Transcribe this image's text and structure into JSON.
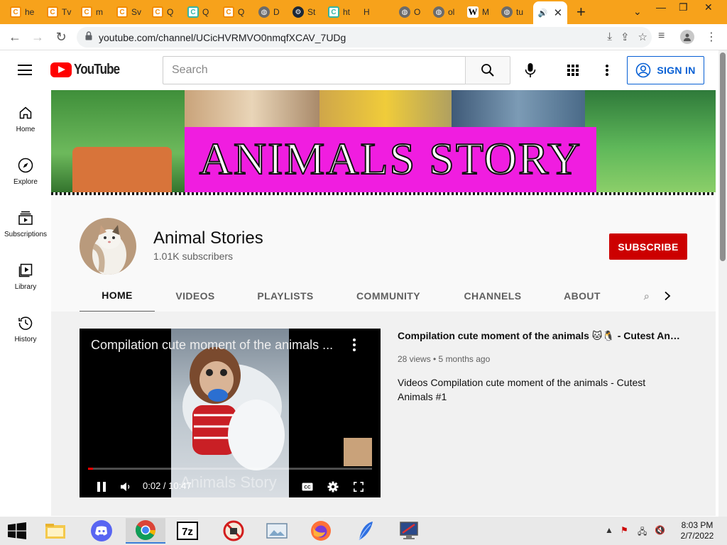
{
  "browser": {
    "tabs": [
      {
        "title": "he",
        "icon": "orange-c-icon"
      },
      {
        "title": "Tv",
        "icon": "orange-c-icon"
      },
      {
        "title": "m",
        "icon": "orange-c-icon"
      },
      {
        "title": "Sv",
        "icon": "orange-c-icon"
      },
      {
        "title": "Q",
        "icon": "orange-c-icon"
      },
      {
        "title": "Q",
        "icon": "teal-c-icon"
      },
      {
        "title": "Q",
        "icon": "orange-c-icon"
      },
      {
        "title": "D",
        "icon": "globe-icon"
      },
      {
        "title": "St",
        "icon": "steam-icon"
      },
      {
        "title": "ht",
        "icon": "teal-c-icon"
      },
      {
        "title": "H",
        "icon": "history-icon"
      },
      {
        "title": "O",
        "icon": "globe-icon"
      },
      {
        "title": "ol",
        "icon": "globe-icon"
      },
      {
        "title": "M",
        "icon": "wikipedia-icon"
      },
      {
        "title": "tu",
        "icon": "globe-icon"
      }
    ],
    "url": "youtube.com/channel/UCicHVRMVO0nmqfXCAV_7UDg"
  },
  "youtube": {
    "logo_text": "YouTube",
    "search_placeholder": "Search",
    "sign_in_label": "SIGN IN",
    "guide": [
      {
        "label": "Home",
        "icon": "home-icon"
      },
      {
        "label": "Explore",
        "icon": "compass-icon"
      },
      {
        "label": "Subscriptions",
        "icon": "subscriptions-icon"
      },
      {
        "label": "Library",
        "icon": "library-icon"
      },
      {
        "label": "History",
        "icon": "history-icon"
      }
    ]
  },
  "channel": {
    "banner_text": "ANIMALS STORY",
    "name": "Animal Stories",
    "subscribers": "1.01K subscribers",
    "subscribe_label": "SUBSCRIBE",
    "tabs": [
      "HOME",
      "VIDEOS",
      "PLAYLISTS",
      "COMMUNITY",
      "CHANNELS",
      "ABOUT"
    ],
    "active_tab": "HOME"
  },
  "featured_video": {
    "player_title": "Compilation cute moment of the animals ...",
    "watermark": "Animals Story",
    "time": "0:02 / 10:47",
    "progress": 0.003,
    "title": "Compilation cute moment of the animals 🐱🐧 - Cutest Animal...",
    "meta": "28 views • 5 months ago",
    "description": "Videos Compilation cute moment of the animals - Cutest Animals #1"
  },
  "taskbar": {
    "apps": [
      "file-explorer-icon",
      "discord-icon",
      "chrome-icon",
      "7zip-icon",
      "blocked-app-icon",
      "photos-icon",
      "firefox-icon",
      "feather-app-icon",
      "monitor-app-icon"
    ],
    "time": "8:03 PM",
    "date": "2/7/2022"
  },
  "colors": {
    "browser_frame": "#f7a21b",
    "youtube_red": "#ff0000",
    "subscribe_red": "#cc0000",
    "link_blue": "#065fd4",
    "banner_pink": "#f01de0"
  }
}
